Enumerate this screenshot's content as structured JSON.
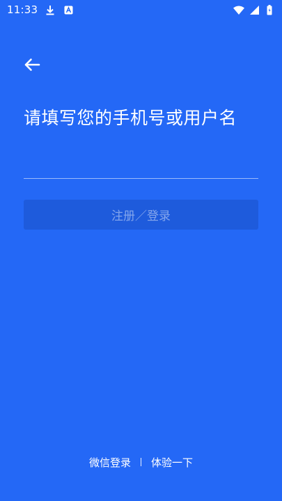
{
  "status_bar": {
    "time": "11:33",
    "icons_left": [
      "download-icon",
      "a-letter-icon"
    ],
    "icons_right": [
      "wifi-icon",
      "signal-icon",
      "battery-icon"
    ]
  },
  "back_icon": "arrow-left-icon",
  "title": "请填写您的手机号或用户名",
  "input": {
    "value": "",
    "placeholder": ""
  },
  "submit_label": "注册／登录",
  "bottom": {
    "wechat_login": "微信登录",
    "separator": "|",
    "trial": "体验一下"
  },
  "colors": {
    "background": "#2468F6",
    "button": "#1E5BDC",
    "text": "#FFFFFF"
  }
}
